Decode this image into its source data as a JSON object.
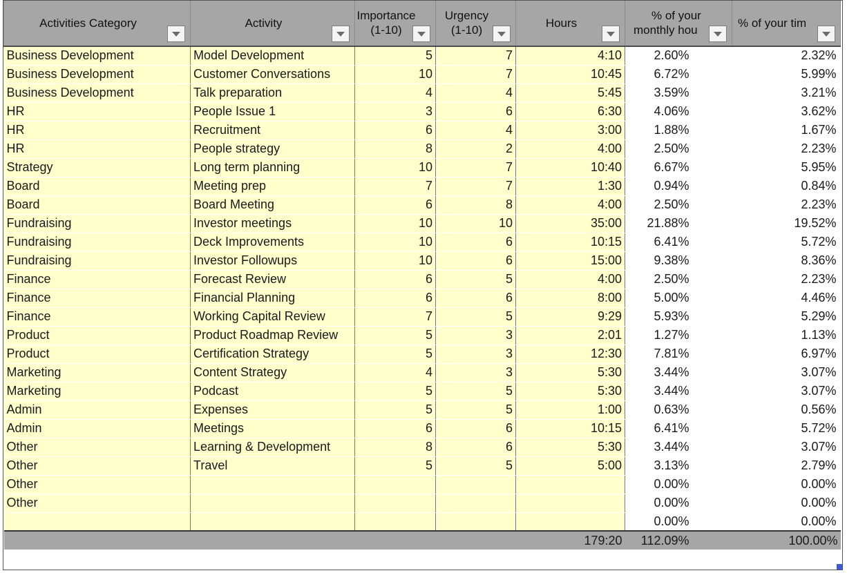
{
  "headers": {
    "category": "Activities Category",
    "activity": "Activity",
    "importance_line1": "Importance",
    "importance_line2": "(1-10)",
    "urgency_line1": "Urgency",
    "urgency_line2": "(1-10)",
    "hours": "Hours",
    "monthly_line1": "% of your",
    "monthly_line2": "monthly hou",
    "time": "% of your tim"
  },
  "icons": {
    "filter": "dropdown-arrow-icon"
  },
  "colors": {
    "header_bg": "#a6a6a6",
    "input_cell_bg": "#ffffcc",
    "selection_handle": "#3b5bdb"
  },
  "rows": [
    {
      "category": "Business Development",
      "activity": "Model Development",
      "importance": "5",
      "urgency": "7",
      "hours": "4:10",
      "pct_monthly": "2.60%",
      "pct_time": "2.32%"
    },
    {
      "category": "Business Development",
      "activity": "Customer Conversations",
      "importance": "10",
      "urgency": "7",
      "hours": "10:45",
      "pct_monthly": "6.72%",
      "pct_time": "5.99%"
    },
    {
      "category": "Business Development",
      "activity": "Talk preparation",
      "importance": "4",
      "urgency": "4",
      "hours": "5:45",
      "pct_monthly": "3.59%",
      "pct_time": "3.21%"
    },
    {
      "category": "HR",
      "activity": "People Issue 1",
      "importance": "3",
      "urgency": "6",
      "hours": "6:30",
      "pct_monthly": "4.06%",
      "pct_time": "3.62%"
    },
    {
      "category": "HR",
      "activity": "Recruitment",
      "importance": "6",
      "urgency": "4",
      "hours": "3:00",
      "pct_monthly": "1.88%",
      "pct_time": "1.67%"
    },
    {
      "category": "HR",
      "activity": "People strategy",
      "importance": "8",
      "urgency": "2",
      "hours": "4:00",
      "pct_monthly": "2.50%",
      "pct_time": "2.23%"
    },
    {
      "category": "Strategy",
      "activity": "Long term planning",
      "importance": "10",
      "urgency": "7",
      "hours": "10:40",
      "pct_monthly": "6.67%",
      "pct_time": "5.95%"
    },
    {
      "category": "Board",
      "activity": "Meeting prep",
      "importance": "7",
      "urgency": "7",
      "hours": "1:30",
      "pct_monthly": "0.94%",
      "pct_time": "0.84%"
    },
    {
      "category": "Board",
      "activity": "Board Meeting",
      "importance": "6",
      "urgency": "8",
      "hours": "4:00",
      "pct_monthly": "2.50%",
      "pct_time": "2.23%"
    },
    {
      "category": "Fundraising",
      "activity": "Investor meetings",
      "importance": "10",
      "urgency": "10",
      "hours": "35:00",
      "pct_monthly": "21.88%",
      "pct_time": "19.52%"
    },
    {
      "category": "Fundraising",
      "activity": "Deck Improvements",
      "importance": "10",
      "urgency": "6",
      "hours": "10:15",
      "pct_monthly": "6.41%",
      "pct_time": "5.72%"
    },
    {
      "category": "Fundraising",
      "activity": "Investor Followups",
      "importance": "10",
      "urgency": "6",
      "hours": "15:00",
      "pct_monthly": "9.38%",
      "pct_time": "8.36%"
    },
    {
      "category": "Finance",
      "activity": "Forecast Review",
      "importance": "6",
      "urgency": "5",
      "hours": "4:00",
      "pct_monthly": "2.50%",
      "pct_time": "2.23%"
    },
    {
      "category": "Finance",
      "activity": "Financial Planning",
      "importance": "6",
      "urgency": "6",
      "hours": "8:00",
      "pct_monthly": "5.00%",
      "pct_time": "4.46%"
    },
    {
      "category": "Finance",
      "activity": "Working Capital Review",
      "importance": "7",
      "urgency": "5",
      "hours": "9:29",
      "pct_monthly": "5.93%",
      "pct_time": "5.29%"
    },
    {
      "category": "Product",
      "activity": "Product Roadmap Review",
      "importance": "5",
      "urgency": "3",
      "hours": "2:01",
      "pct_monthly": "1.27%",
      "pct_time": "1.13%"
    },
    {
      "category": "Product",
      "activity": "Certification Strategy",
      "importance": "5",
      "urgency": "3",
      "hours": "12:30",
      "pct_monthly": "7.81%",
      "pct_time": "6.97%"
    },
    {
      "category": "Marketing",
      "activity": "Content Strategy",
      "importance": "4",
      "urgency": "3",
      "hours": "5:30",
      "pct_monthly": "3.44%",
      "pct_time": "3.07%"
    },
    {
      "category": "Marketing",
      "activity": "Podcast",
      "importance": "5",
      "urgency": "5",
      "hours": "5:30",
      "pct_monthly": "3.44%",
      "pct_time": "3.07%"
    },
    {
      "category": "Admin",
      "activity": "Expenses",
      "importance": "5",
      "urgency": "5",
      "hours": "1:00",
      "pct_monthly": "0.63%",
      "pct_time": "0.56%"
    },
    {
      "category": "Admin",
      "activity": "Meetings",
      "importance": "6",
      "urgency": "6",
      "hours": "10:15",
      "pct_monthly": "6.41%",
      "pct_time": "5.72%"
    },
    {
      "category": "Other",
      "activity": "Learning & Development",
      "importance": "8",
      "urgency": "6",
      "hours": "5:30",
      "pct_monthly": "3.44%",
      "pct_time": "3.07%"
    },
    {
      "category": "Other",
      "activity": "Travel",
      "importance": "5",
      "urgency": "5",
      "hours": "5:00",
      "pct_monthly": "3.13%",
      "pct_time": "2.79%"
    },
    {
      "category": "Other",
      "activity": "",
      "importance": "",
      "urgency": "",
      "hours": "",
      "pct_monthly": "0.00%",
      "pct_time": "0.00%"
    },
    {
      "category": "Other",
      "activity": "",
      "importance": "",
      "urgency": "",
      "hours": "",
      "pct_monthly": "0.00%",
      "pct_time": "0.00%"
    },
    {
      "category": "",
      "activity": "",
      "importance": "",
      "urgency": "",
      "hours": "",
      "pct_monthly": "0.00%",
      "pct_time": "0.00%"
    }
  ],
  "totals": {
    "hours": "179:20",
    "pct_monthly": "112.09%",
    "pct_time": "100.00%"
  }
}
